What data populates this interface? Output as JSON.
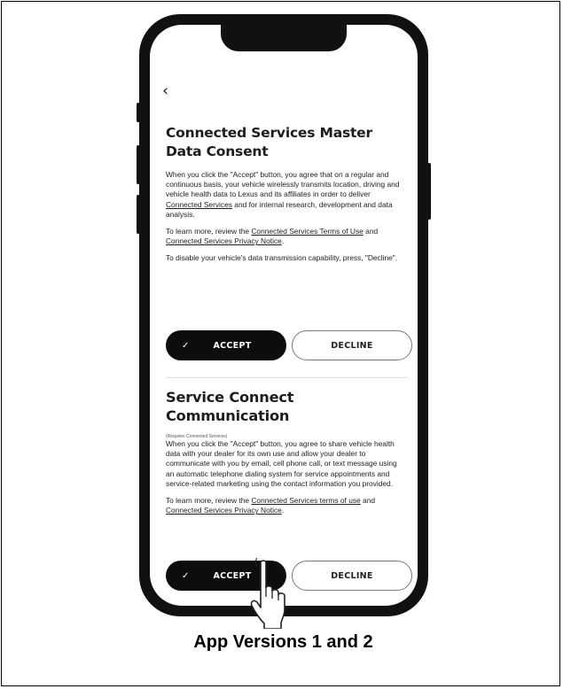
{
  "nav": {
    "back_icon": "‹"
  },
  "section1": {
    "title": "Connected Services Master Data Consent",
    "para1_a": "When you click the \"Accept\" button, you agree that on a regular and continuous basis, your vehicle wirelessly transmits location, driving and vehicle health data to Lexus and its affiliates in order to deliver ",
    "para1_link": "Connected Services",
    "para1_b": " and for internal research, development and data analysis.",
    "para2_a": "To learn more, review the ",
    "para2_link1": "Connected Services Terms of Use",
    "para2_mid": " and ",
    "para2_link2": "Connected Services Privacy Notice",
    "para2_end": ".",
    "para3": "To disable your vehicle's data transmission capability, press, \"Decline\".",
    "accept_label": "ACCEPT",
    "decline_label": "DECLINE"
  },
  "section2": {
    "title": "Service Connect Communication",
    "note": "(Requires Connected Services)",
    "para1": "When you click the \"Accept\" button, you agree to share vehicle health data with your dealer for its own use and allow your dealer to communicate with you by email, cell phone call, or text message using an automatic telephone dialing system for service appointments and service-related marketing using the contact information you provided.",
    "para2_a": "To learn more, review the ",
    "para2_link1": "Connected Services terms of use",
    "para2_mid": " and ",
    "para2_link2": "Connected Services Privacy Notice",
    "para2_end": ".",
    "accept_label": "ACCEPT",
    "decline_label": "DECLINE"
  },
  "icons": {
    "check": "✓",
    "pointer": "hand-pointer-icon"
  },
  "caption": "App Versions 1 and 2"
}
